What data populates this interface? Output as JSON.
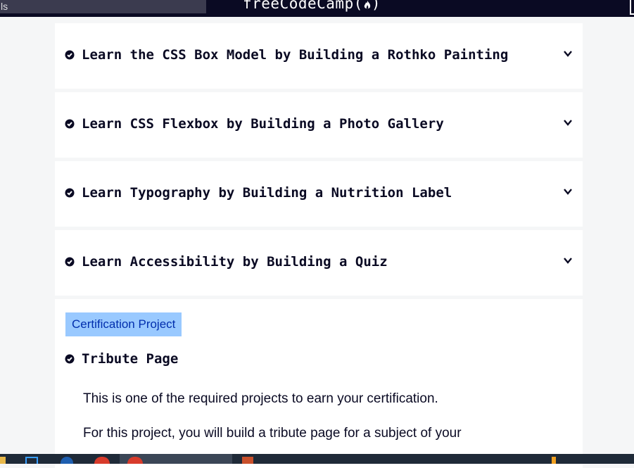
{
  "header": {
    "search_text": "ls",
    "logo_text": "freeCodeCamp(",
    "logo_end": ")"
  },
  "blocks": [
    {
      "title": "Learn the CSS Box Model by Building a Rothko Painting"
    },
    {
      "title": "Learn CSS Flexbox by Building a Photo Gallery"
    },
    {
      "title": "Learn Typography by Building a Nutrition Label"
    },
    {
      "title": "Learn Accessibility by Building a Quiz"
    }
  ],
  "certification": {
    "badge": "Certification Project",
    "title": "Tribute Page",
    "paragraphs": [
      "This is one of the required projects to earn your certification.",
      "For this project, you will build a tribute page for a subject of your"
    ]
  },
  "colors": {
    "nav_bg": "#0a0a23",
    "page_bg": "#f5f6f7",
    "badge_bg": "#99c9ff",
    "badge_text": "#002ead"
  }
}
